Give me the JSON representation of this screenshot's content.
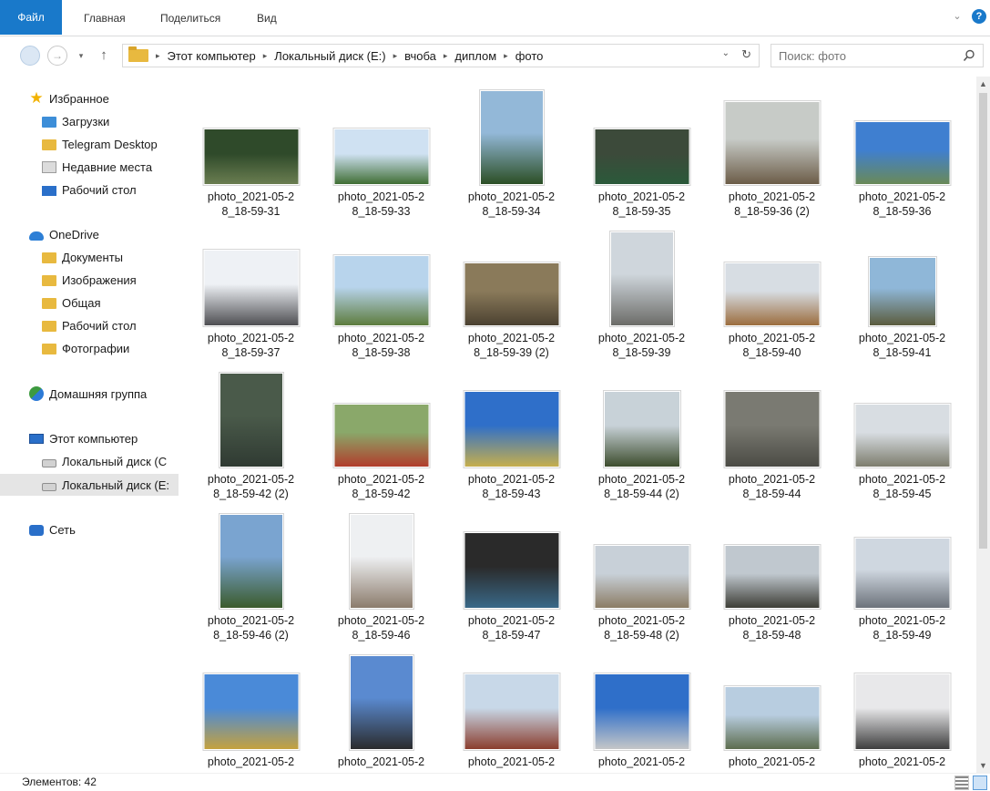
{
  "ribbon": {
    "tabs": [
      "Файл",
      "Главная",
      "Поделиться",
      "Вид"
    ],
    "help_glyph": "?",
    "expand_glyph": "⌄"
  },
  "nav": {
    "back_glyph": "",
    "forward_glyph": "→",
    "history_glyph": "▾",
    "up_glyph": "↑",
    "breadcrumb": [
      "Этот компьютер",
      "Локальный диск (E:)",
      "вчоба",
      "диплом",
      "фото"
    ],
    "breadcrumb_sep": "▸",
    "dropdown_glyph": "⌄",
    "refresh_glyph": "↻"
  },
  "search": {
    "placeholder": "Поиск: фото"
  },
  "sidebar": {
    "favorites": {
      "label": "Избранное",
      "items": [
        "Загрузки",
        "Telegram Desktop",
        "Недавние места",
        "Рабочий стол"
      ]
    },
    "onedrive": {
      "label": "OneDrive",
      "items": [
        "Документы",
        "Изображения",
        "Общая",
        "Рабочий стол",
        "Фотографии"
      ]
    },
    "homegroup": {
      "label": "Домашняя группа"
    },
    "computer": {
      "label": "Этот компьютер",
      "items": [
        "Локальный диск (C",
        "Локальный диск (E:"
      ]
    },
    "network": {
      "label": "Сеть"
    }
  },
  "files": [
    {
      "line1": "photo_2021-05-2",
      "line2": "8_18-59-31",
      "colors": [
        "#2f4a2a",
        "#6c7f52"
      ]
    },
    {
      "line1": "photo_2021-05-2",
      "line2": "8_18-59-33",
      "colors": [
        "#cfe1f2",
        "#3c6b2f"
      ]
    },
    {
      "line1": "photo_2021-05-2",
      "line2": "8_18-59-34",
      "colors": [
        "#93b8d8",
        "#2a4d22"
      ]
    },
    {
      "line1": "photo_2021-05-2",
      "line2": "8_18-59-35",
      "colors": [
        "#3c4a3a",
        "#2a5a3a"
      ]
    },
    {
      "line1": "photo_2021-05-2",
      "line2": "8_18-59-36 (2)",
      "colors": [
        "#c7cbc7",
        "#6a5a45"
      ]
    },
    {
      "line1": "photo_2021-05-2",
      "line2": "8_18-59-36",
      "colors": [
        "#3f7fd0",
        "#6b8a54"
      ]
    },
    {
      "line1": "photo_2021-05-2",
      "line2": "8_18-59-37",
      "colors": [
        "#eef1f5",
        "#4b4b4f"
      ]
    },
    {
      "line1": "photo_2021-05-2",
      "line2": "8_18-59-38",
      "colors": [
        "#b8d4ec",
        "#5b7a3a"
      ]
    },
    {
      "line1": "photo_2021-05-2",
      "line2": "8_18-59-39 (2)",
      "colors": [
        "#8a7a5a",
        "#4a4030"
      ]
    },
    {
      "line1": "photo_2021-05-2",
      "line2": "8_18-59-39",
      "colors": [
        "#cfd6dc",
        "#6a6a66"
      ]
    },
    {
      "line1": "photo_2021-05-2",
      "line2": "8_18-59-40",
      "colors": [
        "#d7dde3",
        "#9a6a3a"
      ]
    },
    {
      "line1": "photo_2021-05-2",
      "line2": "8_18-59-41",
      "colors": [
        "#8fb7d8",
        "#5a5a3a"
      ]
    },
    {
      "line1": "photo_2021-05-2",
      "line2": "8_18-59-42 (2)",
      "colors": [
        "#4a5a4a",
        "#2f3a32"
      ]
    },
    {
      "line1": "photo_2021-05-2",
      "line2": "8_18-59-42",
      "colors": [
        "#8aa86a",
        "#b23a2a"
      ]
    },
    {
      "line1": "photo_2021-05-2",
      "line2": "8_18-59-43",
      "colors": [
        "#2f6fc9",
        "#c9b04a"
      ]
    },
    {
      "line1": "photo_2021-05-2",
      "line2": "8_18-59-44 (2)",
      "colors": [
        "#c8d2d8",
        "#3a4a2a"
      ]
    },
    {
      "line1": "photo_2021-05-2",
      "line2": "8_18-59-44",
      "colors": [
        "#7a7a72",
        "#4a4a44"
      ]
    },
    {
      "line1": "photo_2021-05-2",
      "line2": "8_18-59-45",
      "colors": [
        "#d8dde2",
        "#7a7a6a"
      ]
    },
    {
      "line1": "photo_2021-05-2",
      "line2": "8_18-59-46 (2)",
      "colors": [
        "#7aa4d0",
        "#3a5a2a"
      ]
    },
    {
      "line1": "photo_2021-05-2",
      "line2": "8_18-59-46",
      "colors": [
        "#eef0f2",
        "#8a7a6a"
      ]
    },
    {
      "line1": "photo_2021-05-2",
      "line2": "8_18-59-47",
      "colors": [
        "#2a2a2a",
        "#3a6a8a"
      ]
    },
    {
      "line1": "photo_2021-05-2",
      "line2": "8_18-59-48 (2)",
      "colors": [
        "#c8d0d8",
        "#8a7a62"
      ]
    },
    {
      "line1": "photo_2021-05-2",
      "line2": "8_18-59-48",
      "colors": [
        "#c0c8cf",
        "#3a3a32"
      ]
    },
    {
      "line1": "photo_2021-05-2",
      "line2": "8_18-59-49",
      "colors": [
        "#cfd7e0",
        "#6a7078"
      ]
    },
    {
      "line1": "photo_2021-05-2",
      "line2": "",
      "colors": [
        "#4a8ad8",
        "#c8a23a"
      ]
    },
    {
      "line1": "photo_2021-05-2",
      "line2": "",
      "colors": [
        "#5a8ad0",
        "#2a2a2a"
      ]
    },
    {
      "line1": "photo_2021-05-2",
      "line2": "",
      "colors": [
        "#c8d8e8",
        "#8a3a2a"
      ]
    },
    {
      "line1": "photo_2021-05-2",
      "line2": "",
      "colors": [
        "#2f6fc9",
        "#c8c8c8"
      ]
    },
    {
      "line1": "photo_2021-05-2",
      "line2": "",
      "colors": [
        "#b8cde0",
        "#5a6a4a"
      ]
    },
    {
      "line1": "photo_2021-05-2",
      "line2": "",
      "colors": [
        "#e8e8ea",
        "#3a3a3a"
      ]
    }
  ],
  "status": {
    "items_count": "Элементов: 42"
  },
  "accent": "#1979ca"
}
